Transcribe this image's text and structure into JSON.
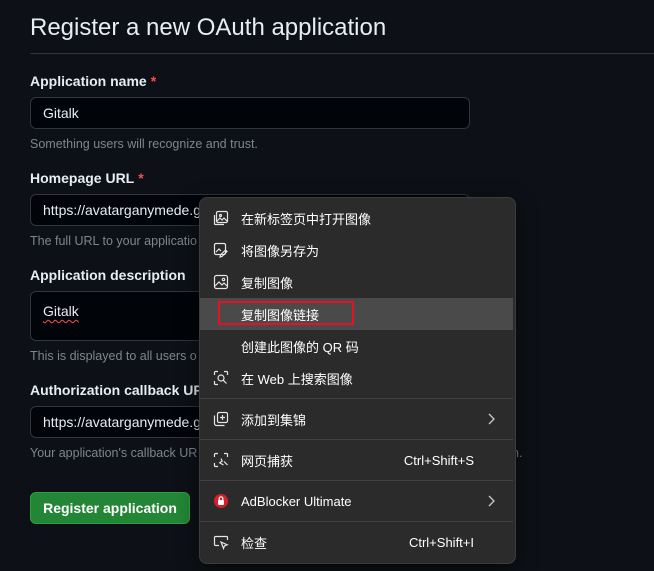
{
  "page": {
    "title": "Register a new OAuth application"
  },
  "form": {
    "required_mark": "*",
    "app_name": {
      "label": "Application name",
      "value": "Gitalk",
      "hint": "Something users will recognize and trust."
    },
    "homepage": {
      "label": "Homepage URL",
      "value": "https://avatarganymede.g",
      "hint": "The full URL to your applicatio"
    },
    "description": {
      "label": "Application description",
      "value": "Gitalk",
      "hint": "This is displayed to all users o"
    },
    "callback": {
      "label": "Authorization callback URL",
      "value": "https://avatarganymede.g",
      "hint": "Your application's callback UR",
      "hint_tail": "n."
    },
    "submit_label": "Register application"
  },
  "context_menu": {
    "highlight_color": "#e81123",
    "items": [
      {
        "label": "在新标签页中打开图像",
        "icon": "open-in-new-tab-icon"
      },
      {
        "label": "将图像另存为",
        "icon": "save-image-icon"
      },
      {
        "label": "复制图像",
        "icon": "copy-image-icon"
      },
      {
        "label": "复制图像链接",
        "icon": ""
      },
      {
        "label": "创建此图像的 QR 码",
        "icon": ""
      },
      {
        "label": "在 Web 上搜索图像",
        "icon": "visual-search-icon"
      },
      {
        "label": "添加到集锦",
        "icon": "collections-icon",
        "submenu": true
      },
      {
        "label": "网页捕获",
        "icon": "web-capture-icon",
        "shortcut": "Ctrl+Shift+S"
      },
      {
        "label": "AdBlocker Ultimate",
        "icon": "adblocker-icon",
        "submenu": true
      },
      {
        "label": "检查",
        "icon": "inspect-icon",
        "shortcut": "Ctrl+Shift+I"
      }
    ]
  }
}
